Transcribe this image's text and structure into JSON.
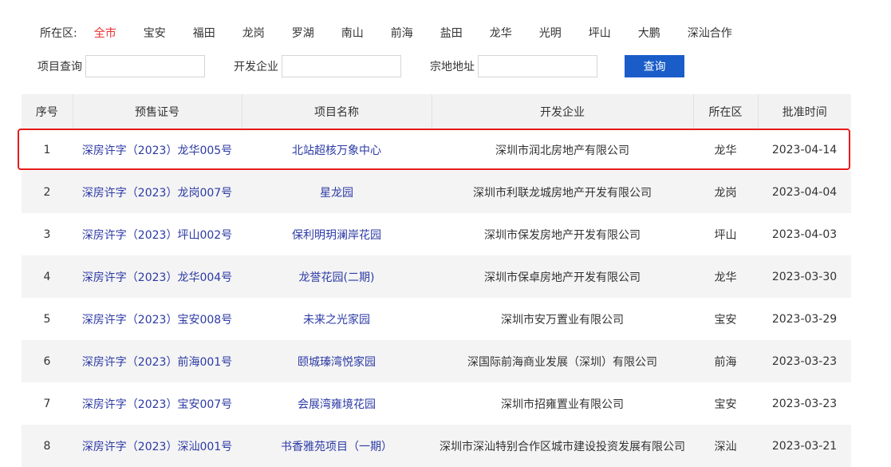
{
  "filters": {
    "district_label": "所在区:",
    "districts": [
      {
        "label": "全市",
        "active": true
      },
      {
        "label": "宝安"
      },
      {
        "label": "福田"
      },
      {
        "label": "龙岗"
      },
      {
        "label": "罗湖"
      },
      {
        "label": "南山"
      },
      {
        "label": "前海"
      },
      {
        "label": "盐田"
      },
      {
        "label": "龙华"
      },
      {
        "label": "光明"
      },
      {
        "label": "坪山"
      },
      {
        "label": "大鹏"
      },
      {
        "label": "深汕合作"
      }
    ]
  },
  "search": {
    "project_label": "项目查询",
    "developer_label": "开发企业",
    "address_label": "宗地地址",
    "button_label": "查询"
  },
  "table": {
    "headers": [
      "序号",
      "预售证号",
      "项目名称",
      "开发企业",
      "所在区",
      "批准时间"
    ],
    "rows": [
      {
        "no": "1",
        "permit": "深房许字（2023）龙华005号",
        "project": "北站超核万象中心",
        "developer": "深圳市润北房地产有限公司",
        "district": "龙华",
        "date": "2023-04-14"
      },
      {
        "no": "2",
        "permit": "深房许字（2023）龙岗007号",
        "project": "星龙园",
        "developer": "深圳市利联龙城房地产开发有限公司",
        "district": "龙岗",
        "date": "2023-04-04"
      },
      {
        "no": "3",
        "permit": "深房许字（2023）坪山002号",
        "project": "保利明玥澜岸花园",
        "developer": "深圳市保发房地产开发有限公司",
        "district": "坪山",
        "date": "2023-04-03"
      },
      {
        "no": "4",
        "permit": "深房许字（2023）龙华004号",
        "project": "龙誉花园(二期)",
        "developer": "深圳市保卓房地产开发有限公司",
        "district": "龙华",
        "date": "2023-03-30"
      },
      {
        "no": "5",
        "permit": "深房许字（2023）宝安008号",
        "project": "未来之光家园",
        "developer": "深圳市安万置业有限公司",
        "district": "宝安",
        "date": "2023-03-29"
      },
      {
        "no": "6",
        "permit": "深房许字（2023）前海001号",
        "project": "颐城瑧湾悦家园",
        "developer": "深国际前海商业发展（深圳）有限公司",
        "district": "前海",
        "date": "2023-03-23"
      },
      {
        "no": "7",
        "permit": "深房许字（2023）宝安007号",
        "project": "会展湾雍境花园",
        "developer": "深圳市招雍置业有限公司",
        "district": "宝安",
        "date": "2023-03-23"
      },
      {
        "no": "8",
        "permit": "深房许字（2023）深汕001号",
        "project": "书香雅苑项目（一期）",
        "developer": "深圳市深汕特别合作区城市建设投资发展有限公司",
        "district": "深汕",
        "date": "2023-03-21"
      }
    ]
  },
  "colors": {
    "accent_active": "#e8312f",
    "button": "#1a5dc8",
    "link": "#2c3aa5",
    "highlight": "#e51c1c"
  }
}
